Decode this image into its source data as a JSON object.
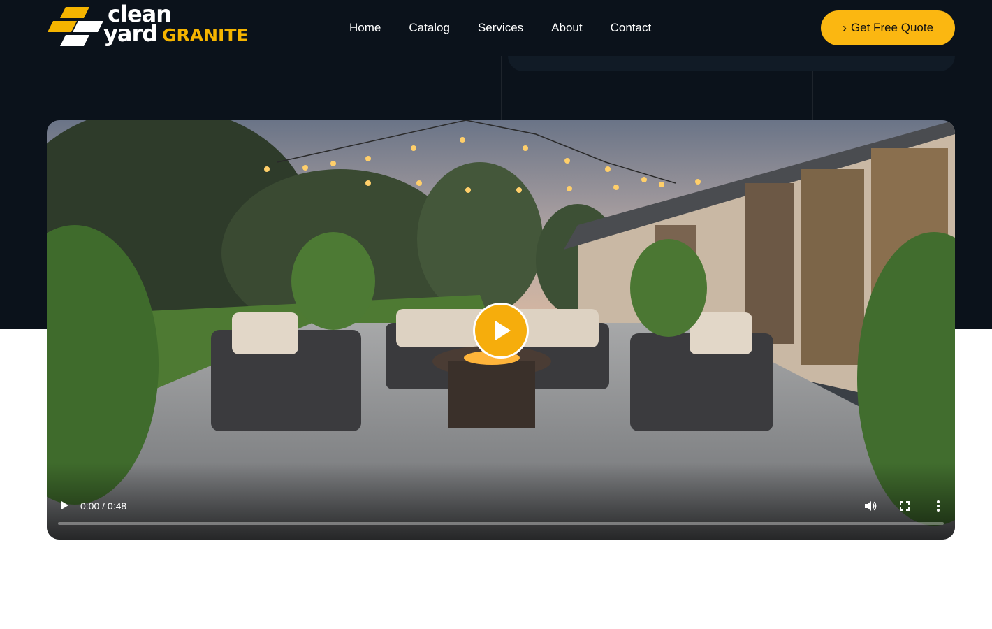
{
  "brand": {
    "logo_line1": "clean",
    "logo_line2": "yard",
    "logo_line3": "GRANITE",
    "accent_color": "#f5b400",
    "dark_bg": "#0b121b"
  },
  "nav": {
    "items": [
      {
        "label": "Home"
      },
      {
        "label": "Catalog"
      },
      {
        "label": "Services"
      },
      {
        "label": "About"
      },
      {
        "label": "Contact"
      }
    ]
  },
  "cta": {
    "label": "Get Free Quote",
    "icon": "chevron-right-icon"
  },
  "video": {
    "time_display": "0:00 / 0:48",
    "progress": 0,
    "icons": {
      "play": "play-icon",
      "volume": "volume-icon",
      "fullscreen": "fullscreen-icon",
      "more": "more-vertical-icon"
    }
  }
}
